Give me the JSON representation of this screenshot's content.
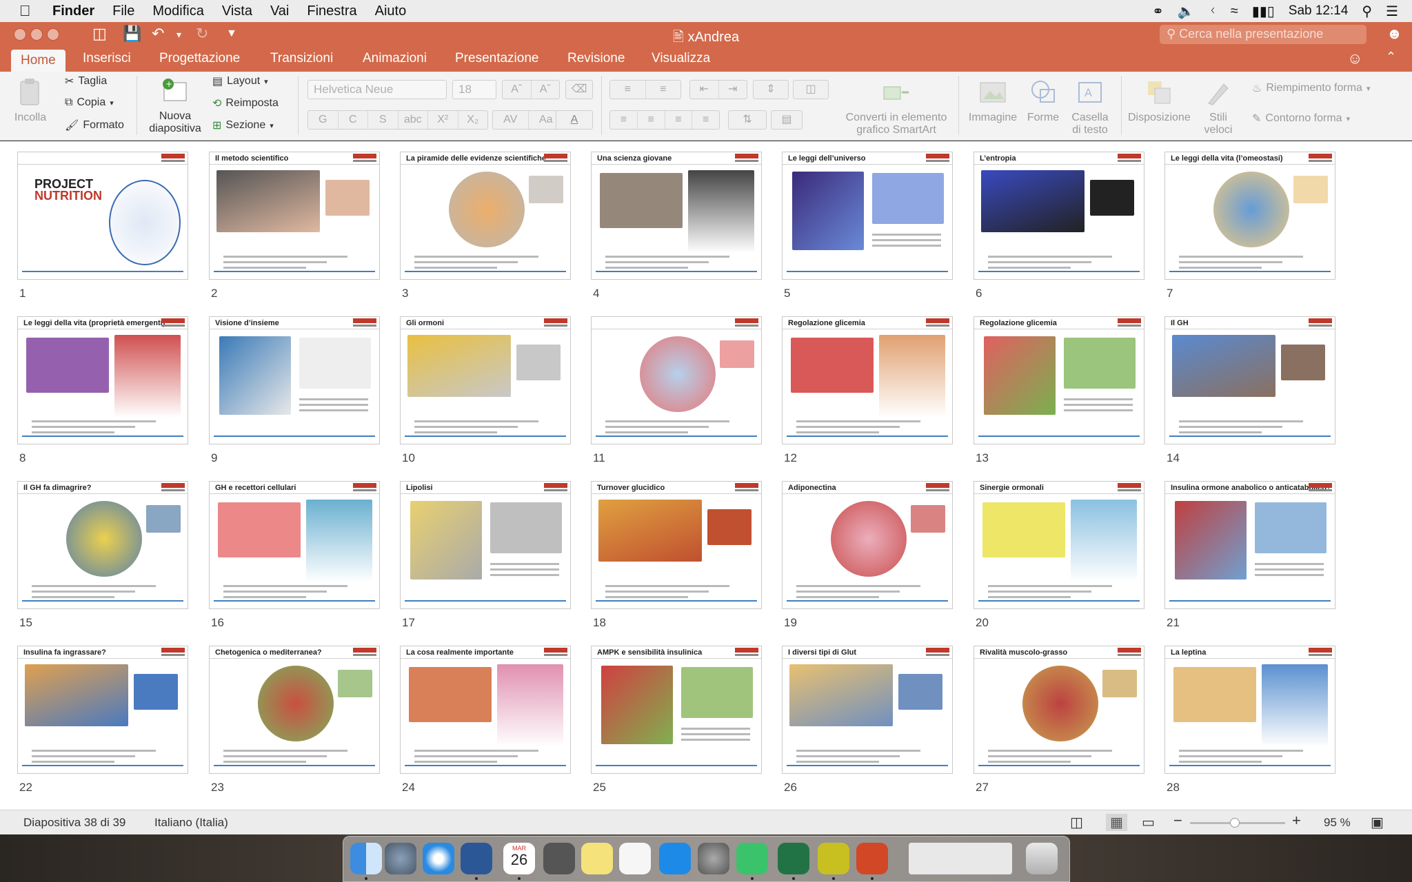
{
  "menubar": {
    "app": "Finder",
    "items": [
      "File",
      "Modifica",
      "Vista",
      "Vai",
      "Finestra",
      "Aiuto"
    ],
    "clock": "Sab 12:14"
  },
  "window": {
    "title": "xAndrea",
    "search_placeholder": "Cerca nella presentazione"
  },
  "tabs": [
    "Home",
    "Inserisci",
    "Progettazione",
    "Transizioni",
    "Animazioni",
    "Presentazione",
    "Revisione",
    "Visualizza"
  ],
  "ribbon": {
    "paste": "Incolla",
    "cut": "Taglia",
    "copy": "Copia",
    "format": "Formato",
    "new_slide_l1": "Nuova",
    "new_slide_l2": "diapositiva",
    "layout": "Layout",
    "reset": "Reimposta",
    "section": "Sezione",
    "font_name": "Helvetica Neue",
    "font_size": "18",
    "smartart_l1": "Converti in elemento",
    "smartart_l2": "grafico SmartArt",
    "image": "Immagine",
    "shapes": "Forme",
    "textbox_l1": "Casella",
    "textbox_l2": "di testo",
    "arrange": "Disposizione",
    "quick_styles_l1": "Stili",
    "quick_styles_l2": "veloci",
    "shape_fill": "Riempimento forma",
    "shape_outline": "Contorno forma"
  },
  "slides": [
    {
      "n": "1",
      "title": ""
    },
    {
      "n": "2",
      "title": "Il metodo scientifico"
    },
    {
      "n": "3",
      "title": "La piramide delle evidenze scientifiche"
    },
    {
      "n": "4",
      "title": "Una scienza giovane"
    },
    {
      "n": "5",
      "title": "Le leggi dell’universo"
    },
    {
      "n": "6",
      "title": "L’entropia"
    },
    {
      "n": "7",
      "title": "Le leggi della vita (l’omeostasi)"
    },
    {
      "n": "8",
      "title": "Le leggi della vita (proprietà emergenti)"
    },
    {
      "n": "9",
      "title": "Visione d’insieme"
    },
    {
      "n": "10",
      "title": "Gli ormoni"
    },
    {
      "n": "11",
      "title": ""
    },
    {
      "n": "12",
      "title": "Regolazione glicemia"
    },
    {
      "n": "13",
      "title": "Regolazione glicemia"
    },
    {
      "n": "14",
      "title": "Il GH"
    },
    {
      "n": "15",
      "title": "Il GH fa dimagrire?"
    },
    {
      "n": "16",
      "title": "GH e recettori cellulari"
    },
    {
      "n": "17",
      "title": "Lipolisi"
    },
    {
      "n": "18",
      "title": "Turnover glucidico"
    },
    {
      "n": "19",
      "title": "Adiponectina"
    },
    {
      "n": "20",
      "title": "Sinergie ormonali"
    },
    {
      "n": "21",
      "title": "Insulina ormone anabolico o anticatabolico?"
    },
    {
      "n": "22",
      "title": "Insulina fa ingrassare?"
    },
    {
      "n": "23",
      "title": "Chetogenica o mediterranea?"
    },
    {
      "n": "24",
      "title": "La cosa realmente importante"
    },
    {
      "n": "25",
      "title": "AMPK e sensibilità insulinica"
    },
    {
      "n": "26",
      "title": "I diversi tipi di Glut"
    },
    {
      "n": "27",
      "title": "Rivalità muscolo-grasso"
    },
    {
      "n": "28",
      "title": "La leptina"
    }
  ],
  "slide1_brand": {
    "l1": "PROJECT",
    "l2": "NUTRITION"
  },
  "status": {
    "slide_counter": "Diapositiva 38 di 39",
    "language": "Italiano (Italia)",
    "zoom": "95 %"
  },
  "dock": {
    "calendar_month": "MAR",
    "calendar_day": "26",
    "apps": [
      "finder-icon",
      "launchpad-icon",
      "safari-icon",
      "word-icon",
      "calendar-icon",
      "calculator-icon",
      "notes-icon",
      "reminders-icon",
      "app-store-icon",
      "system-preferences-icon",
      "whatsapp-icon",
      "excel-icon",
      "fireworks-icon",
      "powerpoint-icon",
      "document-stack-icon",
      "trash-icon"
    ]
  },
  "colors": {
    "accent": "#d3694a",
    "slide_logo": "#c0392b",
    "slide_rule": "#3f7fbf"
  }
}
